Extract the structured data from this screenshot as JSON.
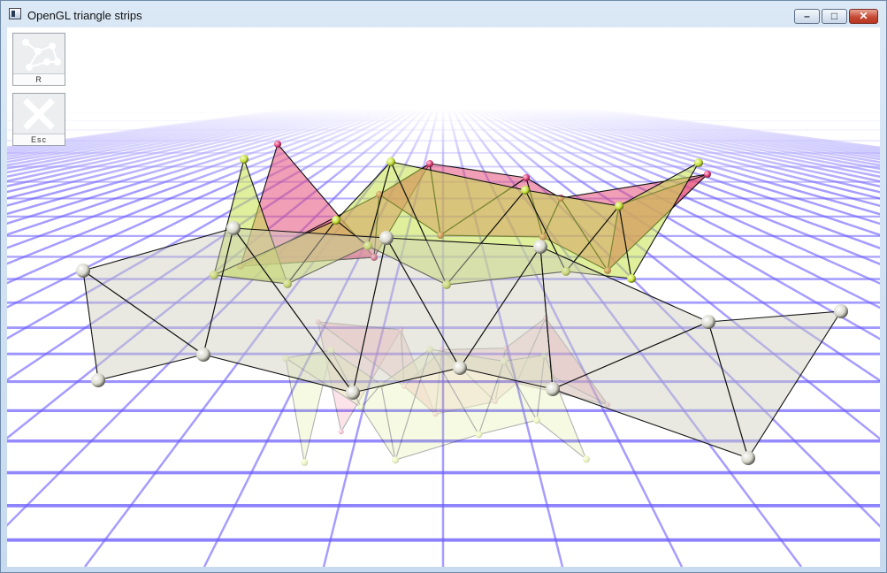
{
  "window": {
    "title": "OpenGL triangle strips",
    "buttons": {
      "minimize": "minimize",
      "maximize": "maximize",
      "close": "close"
    }
  },
  "toolbar": {
    "reset_label": "R",
    "escape_label": "Esc"
  },
  "scene": {
    "strip_colors": {
      "pink": "#e6507a",
      "lime": "#c5e24a",
      "grey": "#cfcfbd"
    },
    "grid_color": "#6b5cff",
    "icons": [
      "network-reset-icon",
      "close-x-icon"
    ]
  }
}
